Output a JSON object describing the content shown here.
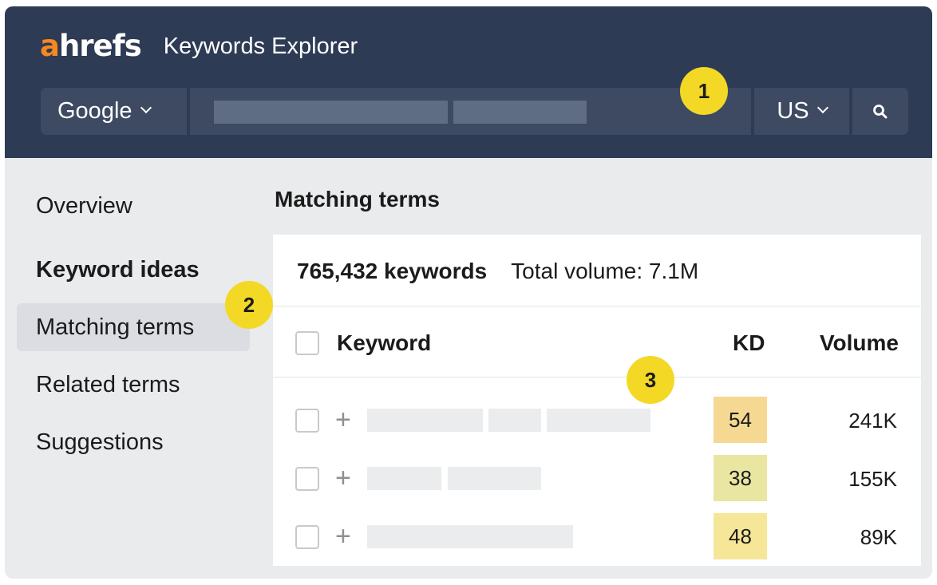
{
  "header": {
    "logo_a": "a",
    "logo_rest": "hrefs",
    "app_title": "Keywords Explorer",
    "engine": "Google",
    "country": "US"
  },
  "sidebar": {
    "items": [
      {
        "label": "Overview",
        "bold": false,
        "active": false
      },
      {
        "label": "Keyword ideas",
        "bold": true,
        "active": false
      },
      {
        "label": "Matching terms",
        "bold": false,
        "active": true
      },
      {
        "label": "Related terms",
        "bold": false,
        "active": false
      },
      {
        "label": "Suggestions",
        "bold": false,
        "active": false
      }
    ]
  },
  "main": {
    "title": "Matching terms",
    "summary": {
      "count": "765,432 keywords",
      "total_volume": "Total volume: 7.1M"
    },
    "table": {
      "columns": [
        "Keyword",
        "KD",
        "Volume"
      ],
      "rows": [
        {
          "kd": "54",
          "volume": "241K",
          "kd_color": "#f5d892"
        },
        {
          "kd": "38",
          "volume": "155K",
          "kd_color": "#e9e6a2"
        },
        {
          "kd": "48",
          "volume": "89K",
          "kd_color": "#f6e698"
        }
      ]
    }
  },
  "annotations": [
    "1",
    "2",
    "3"
  ],
  "colors": {
    "header_bg": "#2e3b54",
    "logo_accent": "#f7871f",
    "badge": "#f3d826",
    "page_bg": "#eaebed"
  },
  "icons": [
    "chevron-down-icon",
    "search-icon",
    "plus-icon"
  ]
}
